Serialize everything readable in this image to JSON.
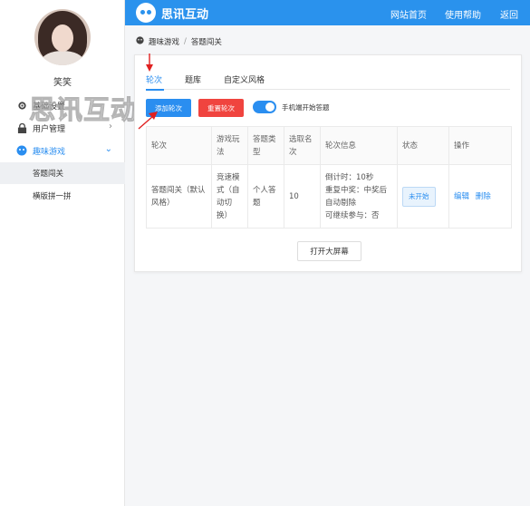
{
  "header": {
    "brand": "思讯互动",
    "nav": [
      "网站首页",
      "使用帮助",
      "返回"
    ]
  },
  "sidebar": {
    "username": "笑笑",
    "items": [
      {
        "label": "基础设置",
        "icon": "gear-icon"
      },
      {
        "label": "用户管理",
        "icon": "user-lock-icon"
      },
      {
        "label": "趣味游戏",
        "icon": "game-icon"
      }
    ],
    "subitems": [
      {
        "label": "答题闯关"
      },
      {
        "label": "横版拼一拼"
      }
    ]
  },
  "watermark": "思讯互动",
  "breadcrumb": {
    "root": "趣味游戏",
    "sep": "/",
    "current": "答题闯关"
  },
  "tabs": [
    "轮次",
    "题库",
    "自定义风格"
  ],
  "actions": {
    "add": "添加轮次",
    "reset": "重置轮次",
    "toggle_label": "手机端开始答题",
    "toggle_on": true
  },
  "table": {
    "headers": [
      "轮次",
      "游戏玩法",
      "答题类型",
      "选取名次",
      "轮次信息",
      "状态",
      "操作"
    ],
    "rows": [
      {
        "round": "答题闯关（默认风格）",
        "mode": "竞速模式（自动切换）",
        "type": "个人答题",
        "rank": "10",
        "info": [
          "倒计时：10秒",
          "重复中奖：中奖后自动剔除",
          "可继续参与：否"
        ],
        "status": "未开始",
        "ops": [
          "编辑",
          "删除"
        ]
      }
    ]
  },
  "screen_button": "打开大屏幕",
  "colors": {
    "primary": "#2a92ed",
    "danger": "#f0443f"
  }
}
